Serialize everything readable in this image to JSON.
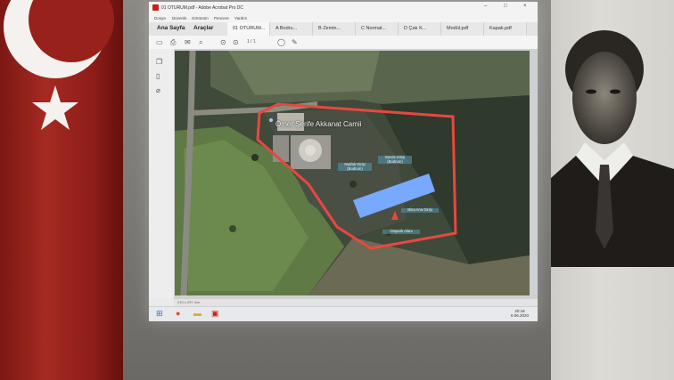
{
  "window": {
    "title": "01 OTURUM.pdf - Adobe Acrobat Pro DC",
    "controls": [
      "–",
      "□",
      "×"
    ]
  },
  "menu": [
    "Dosya",
    "Düzenle",
    "Görünüm",
    "Pencere",
    "Yardım"
  ],
  "tabs": {
    "home": "Ana Sayfa",
    "tools": "Araçlar",
    "docs": [
      "01 OTURUM...",
      "A Bodru...",
      "B Zemin...",
      "C Normal...",
      "D Çatı K...",
      "Modül.pdf",
      "Kapak.pdf"
    ]
  },
  "toolbar": {
    "icons": [
      "save-icon",
      "print-icon",
      "mail-icon",
      "search-icon",
      "page-up-icon",
      "page-down-icon",
      "comment-icon",
      "pen-icon"
    ],
    "page_indicator": "1 / 1"
  },
  "leftpane": {
    "icons": [
      "pages-icon",
      "bookmark-icon",
      "attachment-icon"
    ]
  },
  "map": {
    "place_name": "Ömer Şerife Akkanat Camii",
    "labels": [
      "Mutfak Girişi (Bodrum)",
      "Servis Girişi (Bodrum)",
      "Bina Ana Girişi",
      "Otopark Alanı"
    ],
    "boundary_color": "#e8483f",
    "building_color": "#78a9ff"
  },
  "statusbar": {
    "size": "210 x 297 mm"
  },
  "taskbar": {
    "clock_time": "20:18",
    "clock_date": "6.06.2020"
  }
}
